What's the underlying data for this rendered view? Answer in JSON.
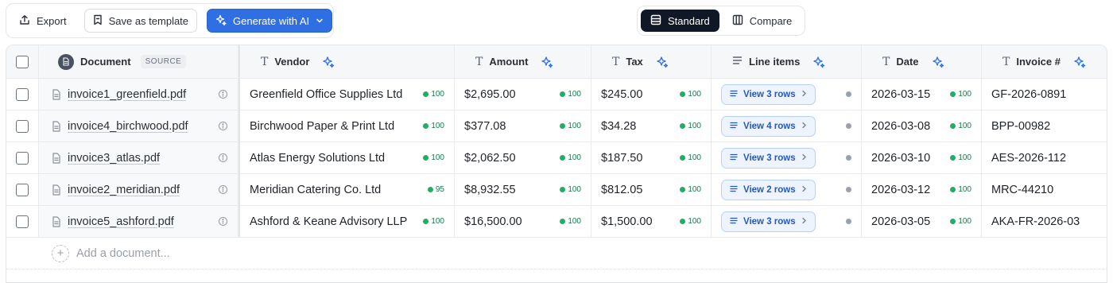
{
  "toolbar": {
    "export_label": "Export",
    "template_label": "Save as template",
    "ai_label": "Generate with AI"
  },
  "view_toggle": {
    "standard_label": "Standard",
    "compare_label": "Compare",
    "active": "Standard"
  },
  "columns": {
    "document": "Document",
    "source_badge": "SOURCE",
    "vendor": "Vendor",
    "amount": "Amount",
    "tax": "Tax",
    "line_items": "Line items",
    "date": "Date",
    "invoice": "Invoice #"
  },
  "rows": [
    {
      "file": "invoice1_greenfield.pdf",
      "vendor": "Greenfield Office Supplies Ltd",
      "vendor_conf": "100",
      "amount": "$2,695.00",
      "amount_conf": "100",
      "tax": "$245.00",
      "tax_conf": "100",
      "line_items": "View 3 rows",
      "date": "2026-03-15",
      "date_conf": "100",
      "invoice": "GF-2026-0891"
    },
    {
      "file": "invoice4_birchwood.pdf",
      "vendor": "Birchwood Paper & Print Ltd",
      "vendor_conf": "100",
      "amount": "$377.08",
      "amount_conf": "100",
      "tax": "$34.28",
      "tax_conf": "100",
      "line_items": "View 4 rows",
      "date": "2026-03-08",
      "date_conf": "100",
      "invoice": "BPP-00982"
    },
    {
      "file": "invoice3_atlas.pdf",
      "vendor": "Atlas Energy Solutions Ltd",
      "vendor_conf": "100",
      "amount": "$2,062.50",
      "amount_conf": "100",
      "tax": "$187.50",
      "tax_conf": "100",
      "line_items": "View 3 rows",
      "date": "2026-03-10",
      "date_conf": "100",
      "invoice": "AES-2026-112"
    },
    {
      "file": "invoice2_meridian.pdf",
      "vendor": "Meridian Catering Co. Ltd",
      "vendor_conf": "95",
      "amount": "$8,932.55",
      "amount_conf": "100",
      "tax": "$812.05",
      "tax_conf": "100",
      "line_items": "View 2 rows",
      "date": "2026-03-12",
      "date_conf": "100",
      "invoice": "MRC-44210"
    },
    {
      "file": "invoice5_ashford.pdf",
      "vendor": "Ashford & Keane Advisory LLP",
      "vendor_conf": "100",
      "amount": "$16,500.00",
      "amount_conf": "100",
      "tax": "$1,500.00",
      "tax_conf": "100",
      "line_items": "View 3 rows",
      "date": "2026-03-05",
      "date_conf": "100",
      "invoice": "AKA-FR-2026-03"
    }
  ],
  "add_document_label": "Add a document...",
  "colors": {
    "accent": "#2f6fe4",
    "confidence_green": "#1fae63",
    "neutral_dot": "#9aa0a8",
    "active_toggle": "#101828"
  }
}
